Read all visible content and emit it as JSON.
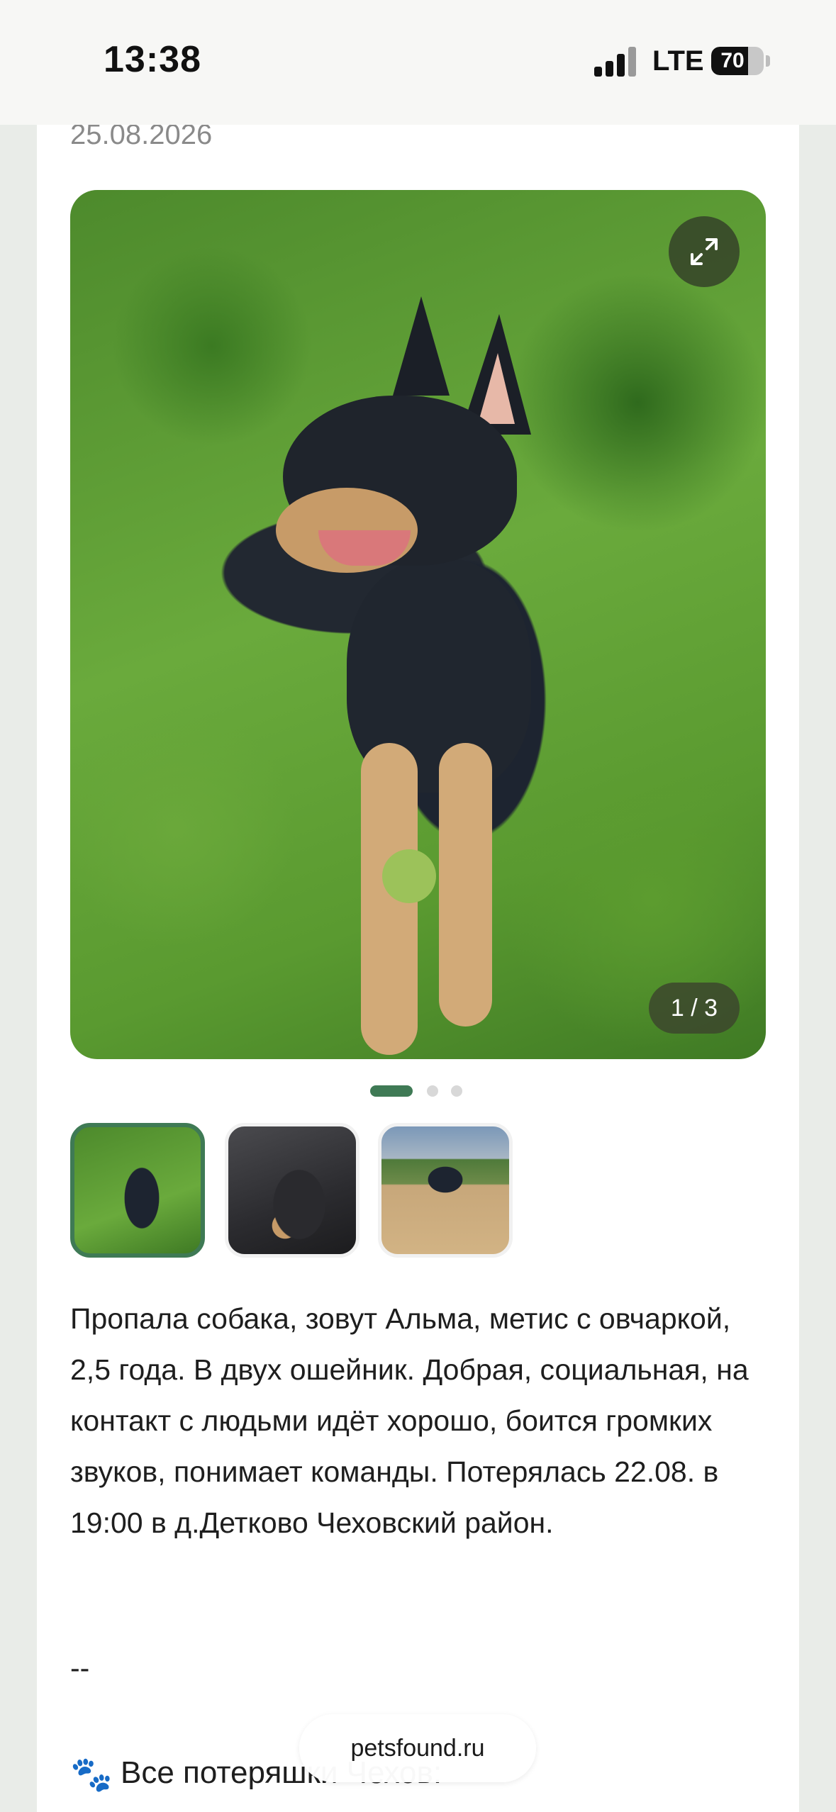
{
  "status_bar": {
    "time": "13:38",
    "network": "LTE",
    "battery": "70",
    "battery_level": 0.7
  },
  "post": {
    "date": "25.08.2026",
    "gallery": {
      "counter": "1 / 3",
      "total_photos": 3,
      "active_index": 1
    },
    "description": "Пропала собака, зовут Альма, метис с овчаркой, 2,5 года. В двух ошейник. Добрая, социальная, на контакт с людьми идёт хорошо, боится громких звуков, понимает команды. Потерялась 22.08. в 19:00 в д.Детково Чеховский район.",
    "separator": "--",
    "footer_link_icon": "🐾",
    "footer_link_text": "Все потеряшки Чехов:"
  },
  "browser": {
    "url": "petsfound.ru"
  },
  "colors": {
    "accent": "#3f7a55",
    "text": "#1e1e1e",
    "muted": "#8a8a8a"
  }
}
